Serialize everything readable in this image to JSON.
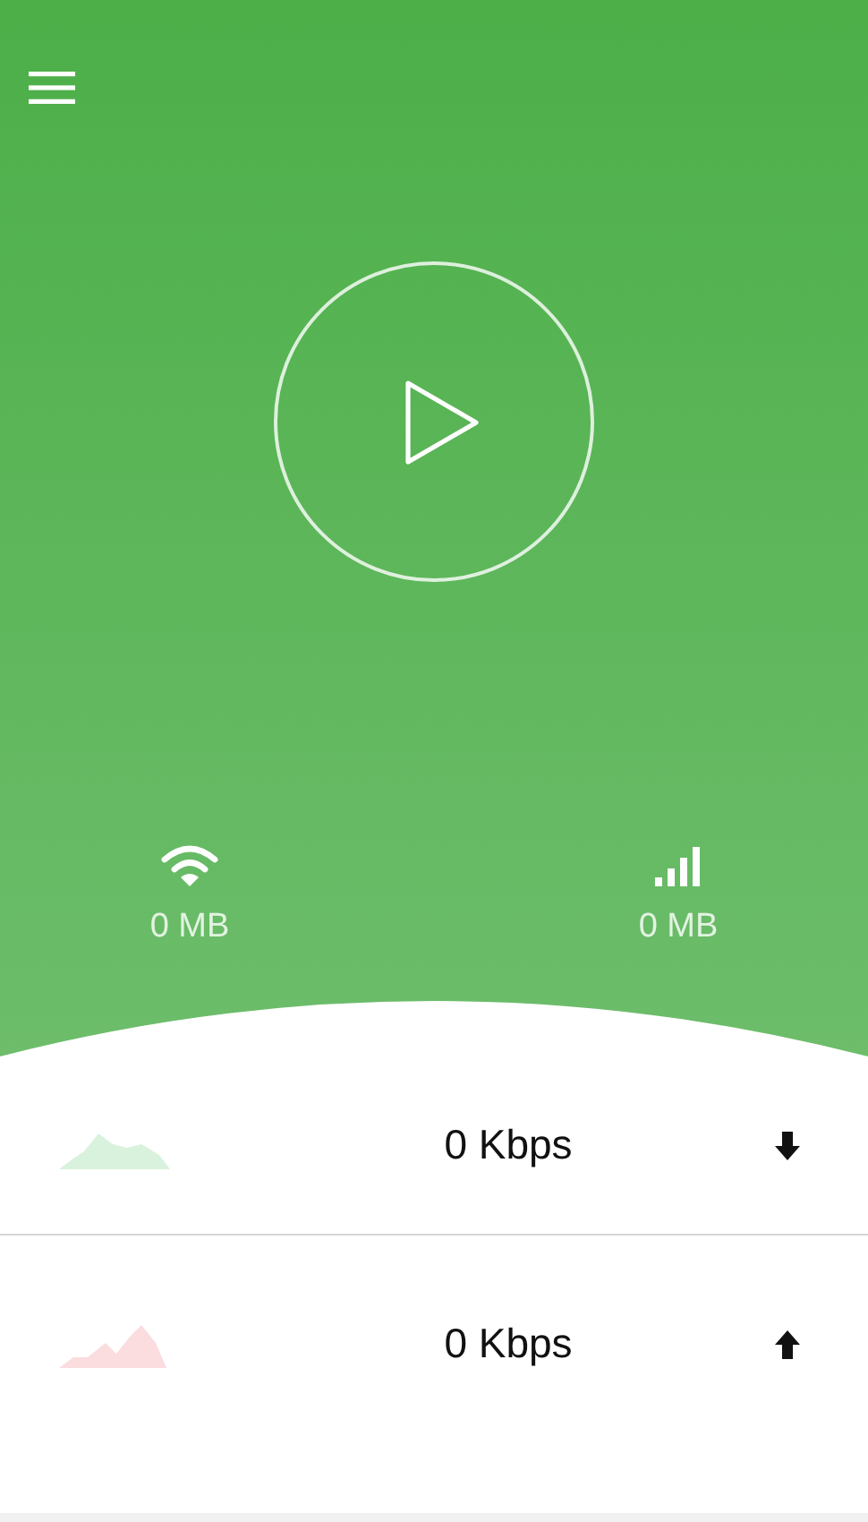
{
  "header": {
    "play_button": {
      "kind": "play"
    },
    "usage": [
      {
        "kind": "wifi",
        "amount": "0 MB"
      },
      {
        "kind": "cellular",
        "amount": "0 MB"
      }
    ]
  },
  "speeds": [
    {
      "kind": "download",
      "reading": "0 Kbps",
      "color": "#d9f2dd"
    },
    {
      "kind": "upload",
      "reading": "0 Kbps",
      "color": "#fbdcdf"
    }
  ]
}
